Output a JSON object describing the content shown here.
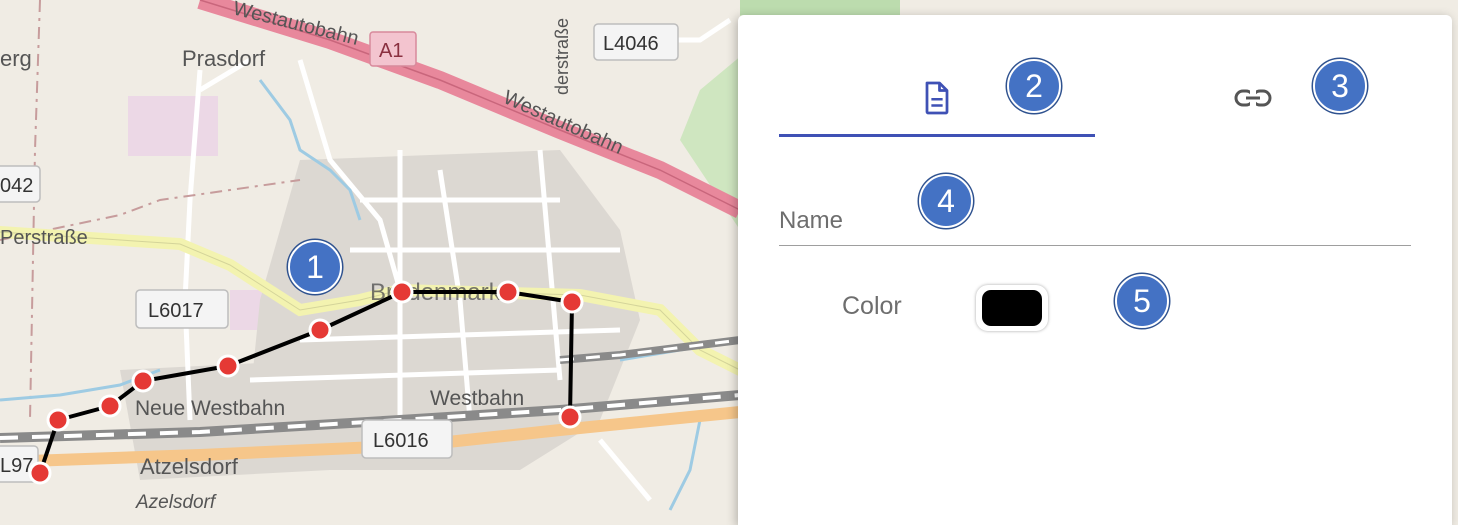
{
  "map": {
    "labels": {
      "westautobahn_1": "Westautobahn",
      "westautobahn_2": "Westautobahn",
      "a1": "A1",
      "l4046": "L4046",
      "strasse_top": "derstraße",
      "prasdorf": "Prasdorf",
      "berg": "erg",
      "l042": "042",
      "perstrasse": "Perstraße",
      "l6017": "L6017",
      "bruedenmarkt": "Brüdenmarkt",
      "neue_westbahn": "Neue Westbahn",
      "westbahn": "Westbahn",
      "l6016": "L6016",
      "l97": "L97",
      "atzelsdorf": "Atzelsdorf",
      "azelsdorf": "Azelsdorf"
    },
    "line_color": "#000000",
    "point_color": "#e53935"
  },
  "panel": {
    "tabs": [
      {
        "icon": "document-icon",
        "active": true
      },
      {
        "icon": "link-icon",
        "active": false
      }
    ],
    "name_placeholder": "Name",
    "name_value": "",
    "color_label": "Color",
    "color_value": "#000000",
    "accent": "#3f51b5"
  },
  "callouts": {
    "c1": "1",
    "c2": "2",
    "c3": "3",
    "c4": "4",
    "c5": "5"
  }
}
